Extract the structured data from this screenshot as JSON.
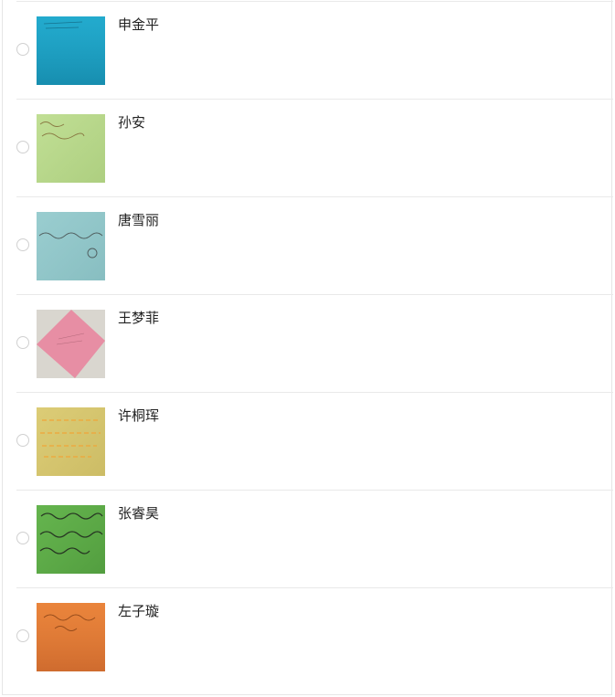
{
  "items": [
    {
      "name": "申金平",
      "note_color": "#1ea5c8"
    },
    {
      "name": "孙安",
      "note_color": "#b9d98c"
    },
    {
      "name": "唐雪丽",
      "note_color": "#94c9cc"
    },
    {
      "name": "王梦菲",
      "note_color": "#e78ea4"
    },
    {
      "name": "许桐珲",
      "note_color": "#d8c870"
    },
    {
      "name": "张睿昊",
      "note_color": "#5fae4a"
    },
    {
      "name": "左子璇",
      "note_color": "#e88038"
    }
  ]
}
